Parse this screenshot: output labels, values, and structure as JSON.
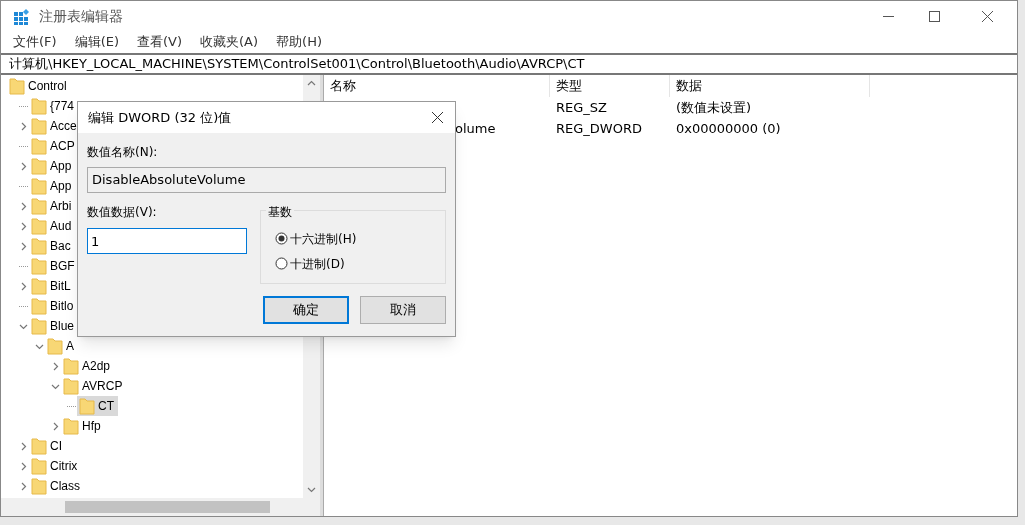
{
  "window": {
    "title": "注册表编辑器"
  },
  "menu": [
    "文件(F)",
    "编辑(E)",
    "查看(V)",
    "收藏夹(A)",
    "帮助(H)"
  ],
  "address": "计算机\\HKEY_LOCAL_MACHINE\\SYSTEM\\ControlSet001\\Control\\Bluetooth\\Audio\\AVRCP\\CT",
  "tree": [
    {
      "label": "Control",
      "kind": "root",
      "selected": false,
      "children": [
        {
          "label": "{774",
          "kind": "leaf",
          "selected": false
        },
        {
          "label": "Acce",
          "kind": "branch",
          "expanded": false,
          "selected": false
        },
        {
          "label": "ACP",
          "kind": "leaf",
          "selected": false
        },
        {
          "label": "App",
          "kind": "branch",
          "expanded": false,
          "selected": false
        },
        {
          "label": "App",
          "kind": "leaf",
          "selected": false
        },
        {
          "label": "Arbi",
          "kind": "branch",
          "expanded": false,
          "selected": false
        },
        {
          "label": "Aud",
          "kind": "branch",
          "expanded": false,
          "selected": false
        },
        {
          "label": "Bac",
          "kind": "branch",
          "expanded": false,
          "selected": false
        },
        {
          "label": "BGF",
          "kind": "leaf",
          "selected": false
        },
        {
          "label": "BitL",
          "kind": "branch",
          "expanded": false,
          "selected": false
        },
        {
          "label": "Bitlo",
          "kind": "leaf",
          "selected": false
        },
        {
          "label": "Blue",
          "kind": "branch",
          "expanded": true,
          "selected": false,
          "children": [
            {
              "label": "A",
              "kind": "branch",
              "expanded": true,
              "selected": false,
              "children": [
                {
                  "label": "A2dp",
                  "kind": "branch",
                  "expanded": false,
                  "selected": false
                },
                {
                  "label": "AVRCP",
                  "kind": "branch",
                  "expanded": true,
                  "selected": false,
                  "children": [
                    {
                      "label": "CT",
                      "kind": "leaf",
                      "selected": true
                    }
                  ]
                },
                {
                  "label": "Hfp",
                  "kind": "branch",
                  "expanded": false,
                  "selected": false
                }
              ]
            }
          ]
        },
        {
          "label": "CI",
          "kind": "branch",
          "expanded": false,
          "selected": false
        },
        {
          "label": "Citrix",
          "kind": "branch",
          "expanded": false,
          "selected": false
        },
        {
          "label": "Class",
          "kind": "branch",
          "expanded": false,
          "selected": false
        }
      ]
    }
  ],
  "table": {
    "columns": [
      "名称",
      "类型",
      "数据"
    ],
    "rows": [
      {
        "type": "REG_SZ",
        "data": "(数值未设置)"
      },
      {
        "name": "olume",
        "type": "REG_DWORD",
        "data": "0x00000000 (0)"
      }
    ]
  },
  "dialog": {
    "title": "编辑 DWORD (32 位)值",
    "name_label": "数值名称(N):",
    "name_value": "DisableAbsoluteVolume",
    "data_label": "数值数据(V):",
    "data_value": "1",
    "base_label": "基数",
    "radios": [
      {
        "label": "十六进制(H)",
        "selected": true
      },
      {
        "label": "十进制(D)",
        "selected": false
      }
    ],
    "buttons": [
      {
        "label": "确定",
        "kind": "default"
      },
      {
        "label": "取消",
        "kind": "normal"
      }
    ]
  }
}
